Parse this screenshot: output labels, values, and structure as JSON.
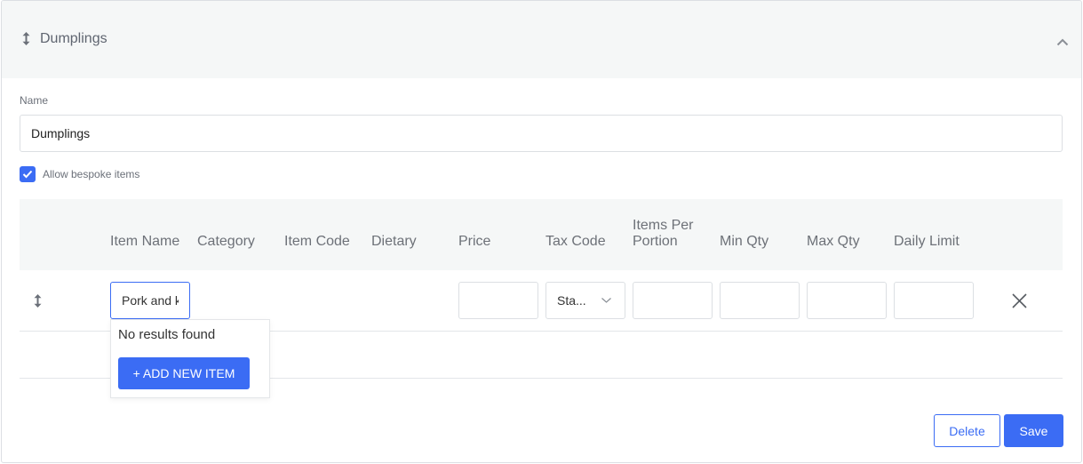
{
  "section": {
    "title": "Dumplings",
    "drag_icon": "drag-handle-icon",
    "toggle_icon": "chevron-up-icon",
    "expanded": true
  },
  "form": {
    "name_label": "Name",
    "name_value": "Dumplings",
    "bespoke_label": "Allow bespoke items",
    "bespoke_checked": true
  },
  "table": {
    "headers": {
      "item_name": "Item Name",
      "category": "Category",
      "item_code": "Item Code",
      "dietary": "Dietary",
      "price": "Price",
      "tax_code": "Tax Code",
      "items_per_portion": "Items Per Portion",
      "min_qty": "Min Qty",
      "max_qty": "Max Qty",
      "daily_limit": "Daily Limit"
    },
    "rows": [
      {
        "item_name": "Pork and k",
        "price": "",
        "tax_code": "Sta...",
        "items_per_portion": "",
        "min_qty": "",
        "max_qty": "",
        "daily_limit": "",
        "drag_icon": "drag-handle-icon",
        "tax_code_icon": "chevron-down-icon",
        "remove_icon": "close-icon"
      }
    ]
  },
  "autocomplete": {
    "message": "No results found",
    "add_button_label": "+ ADD NEW ITEM"
  },
  "actions": {
    "delete_label": "Delete",
    "save_label": "Save"
  },
  "colors": {
    "accent": "#3b6cf4",
    "panel_bg": "#f5f7f7",
    "border": "#dcdfe3",
    "muted_text": "#6b7079"
  }
}
